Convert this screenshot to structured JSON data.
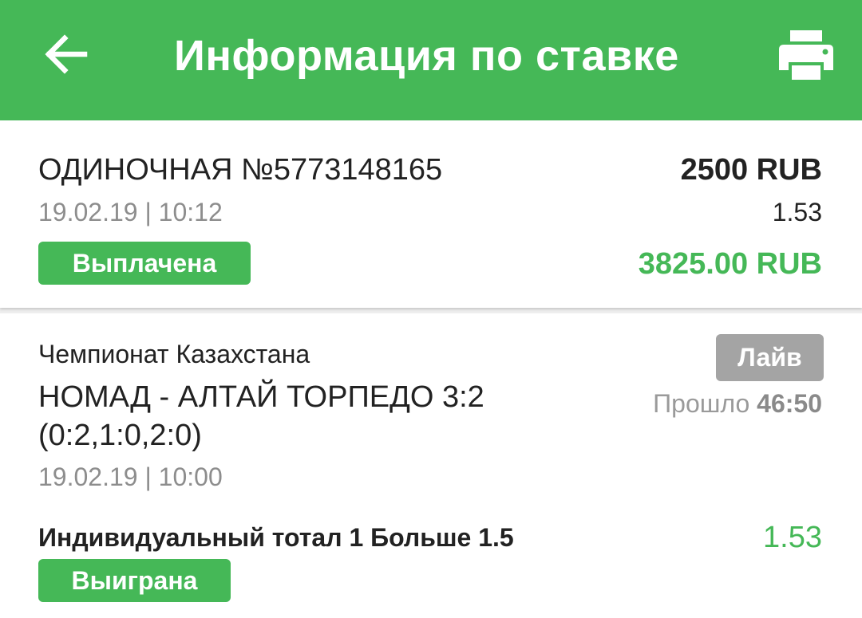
{
  "header": {
    "title": "Информация по ставке",
    "back_icon": "arrow-left-icon",
    "print_icon": "printer-icon",
    "background_color": "#45b857"
  },
  "bet": {
    "type_number": "ОДИНОЧНАЯ №5773148165",
    "datetime": "19.02.19 | 10:12",
    "status": "Выплачена",
    "amount": "2500 RUB",
    "coefficient": "1.53",
    "payout": "3825.00 RUB"
  },
  "event": {
    "league": "Чемпионат Казахстана",
    "match_line1": "НОМАД - АЛТАЙ ТОРПЕДО 3:2",
    "match_line2": "(0:2,1:0,2:0)",
    "datetime": "19.02.19 | 10:00",
    "live_label": "Лайв",
    "elapsed_label": "Прошло",
    "elapsed_time": "46:50",
    "market": "Индивидуальный тотал 1 Больше 1.5",
    "market_coefficient": "1.53",
    "market_status": "Выиграна"
  },
  "colors": {
    "accent_green": "#45b857",
    "live_gray": "#a4a4a4",
    "muted_text": "#8d8d8d"
  }
}
